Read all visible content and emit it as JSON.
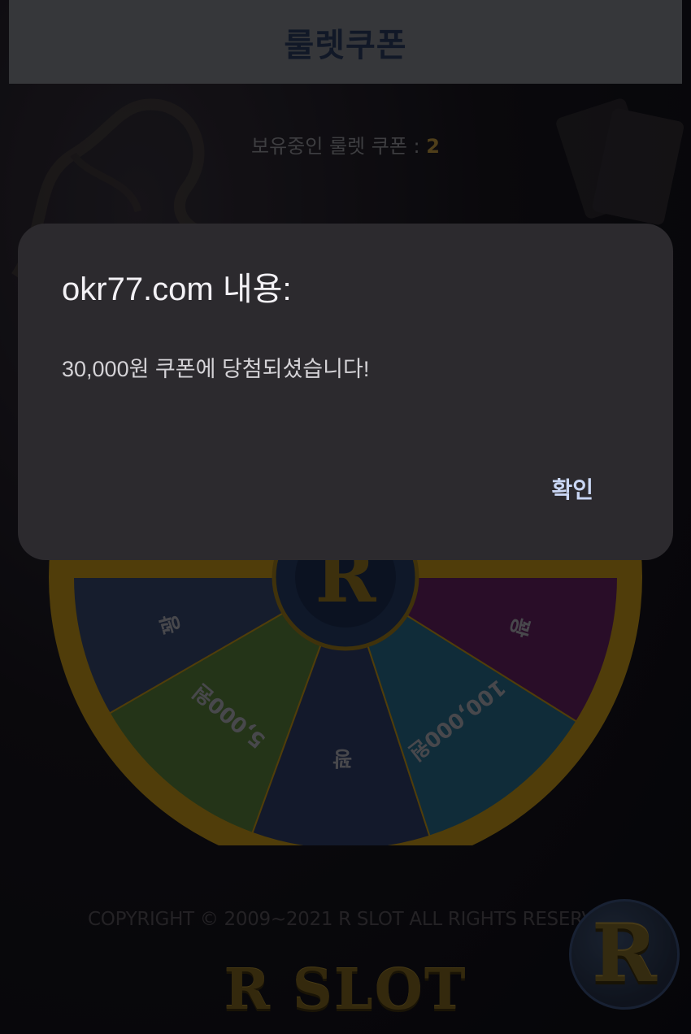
{
  "header": {
    "title": "룰렛쿠폰"
  },
  "coupon_status": {
    "label": "보유중인 룰렛 쿠폰 : ",
    "count": "2"
  },
  "wheel": {
    "segments": [
      {
        "label": "꽝",
        "color": "#26334f"
      },
      {
        "label": "5,000원",
        "color": "#3f5a2a"
      },
      {
        "label": "꽝",
        "color": "#222c4a"
      },
      {
        "label": "100,000원",
        "color": "#1d4d63"
      },
      {
        "label": "꽝",
        "color": "#481846"
      }
    ],
    "rim_color": "#8a6a12"
  },
  "footer": {
    "copyright": "COPYRIGHT © 2009~2021 R SLOT ALL RIGHTS RESERVED",
    "logo_text": "R SLOT"
  },
  "floating_logo": {
    "text": "R"
  },
  "dialog": {
    "title": "okr77.com 내용:",
    "message": "30,000원 쿠폰에 당첨되셨습니다!",
    "ok_label": "확인"
  }
}
